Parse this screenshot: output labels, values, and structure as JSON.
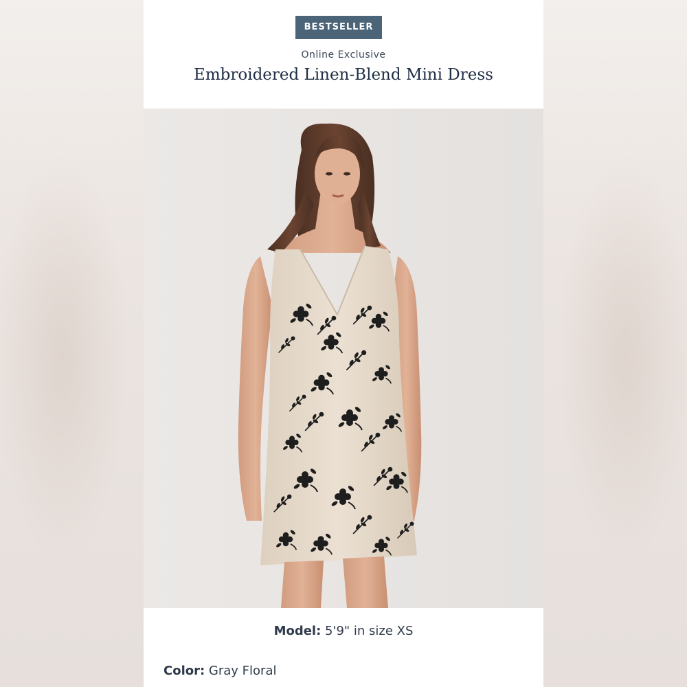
{
  "header": {
    "badge": "BESTSELLER",
    "subtitle": "Online Exclusive",
    "title": "Embroidered Linen-Blend Mini Dress"
  },
  "product_image": {
    "subject": "model wearing embroidered linen-blend mini dress"
  },
  "details": {
    "model_label": "Model:",
    "model_value": "5'9\" in size XS",
    "color_label": "Color:",
    "color_value": "Gray Floral"
  },
  "colors": {
    "badge_bg": "#4b6478",
    "title_text": "#1f2d44",
    "dress_fabric": "#e6dbcc",
    "embroidery": "#1e1e1e"
  }
}
